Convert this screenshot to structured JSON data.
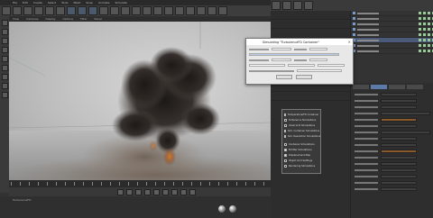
{
  "menubar": {
    "items": [
      "File",
      "Edit",
      "Create",
      "Select",
      "Tools",
      "Mesh",
      "Snap",
      "Animate",
      "Simulate",
      "Render",
      "Sculpt",
      "Motion Tracker",
      "MoGraph",
      "Character",
      "Pipeline",
      "Plugins",
      "Script",
      "Window",
      "Help"
    ]
  },
  "viewport": {
    "header": [
      "View",
      "Cameras",
      "Display",
      "Options",
      "Filter",
      "Panel",
      "ProRender"
    ]
  },
  "dialog": {
    "title": "Simulating \"TurbulenceFD Container\"",
    "close": "×",
    "fields": [
      "Frame",
      "Elapsed",
      "Voxels",
      "Memory"
    ]
  },
  "checkbox_panel": {
    "items": [
      {
        "label": "Temperature/FD Container",
        "checked": true
      },
      {
        "label": "Turbulence Simulations",
        "checked": false
      },
      {
        "label": "Voxel Grid Simulations",
        "checked": false
      },
      {
        "label": "Sim. Container Simulations",
        "checked": false
      },
      {
        "label": "Sim. Resolution Simulations",
        "checked": false
      },
      {
        "label": "Container Simulations",
        "checked": false
      },
      {
        "label": "Emitter Simulations",
        "checked": true
      },
      {
        "label": "Displacement Map",
        "checked": true
      },
      {
        "label": "Object Grid Settings",
        "checked": false
      },
      {
        "label": "Rendering Simulations",
        "checked": false
      }
    ]
  },
  "statusbar": {
    "label": "TurbulenceFD"
  },
  "colors": {
    "accent": "#5c7aa8",
    "smoke": "#2a2523",
    "fire": "#c05a18"
  }
}
